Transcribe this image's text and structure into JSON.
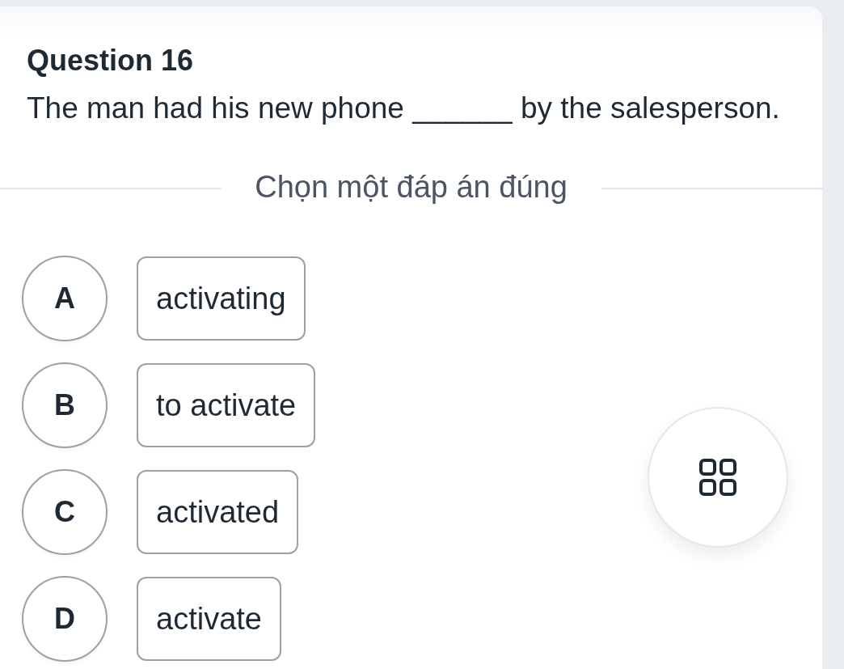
{
  "question": {
    "title": "Question 16",
    "text": "The man had his new phone ______ by the salesperson."
  },
  "instruction": "Chọn một đáp án đúng",
  "options": [
    {
      "letter": "A",
      "text": "activating",
      "selected": false
    },
    {
      "letter": "B",
      "text": "to activate",
      "selected": false
    },
    {
      "letter": "C",
      "text": "activated",
      "selected": false
    },
    {
      "letter": "D",
      "text": "activate",
      "selected": false
    }
  ]
}
